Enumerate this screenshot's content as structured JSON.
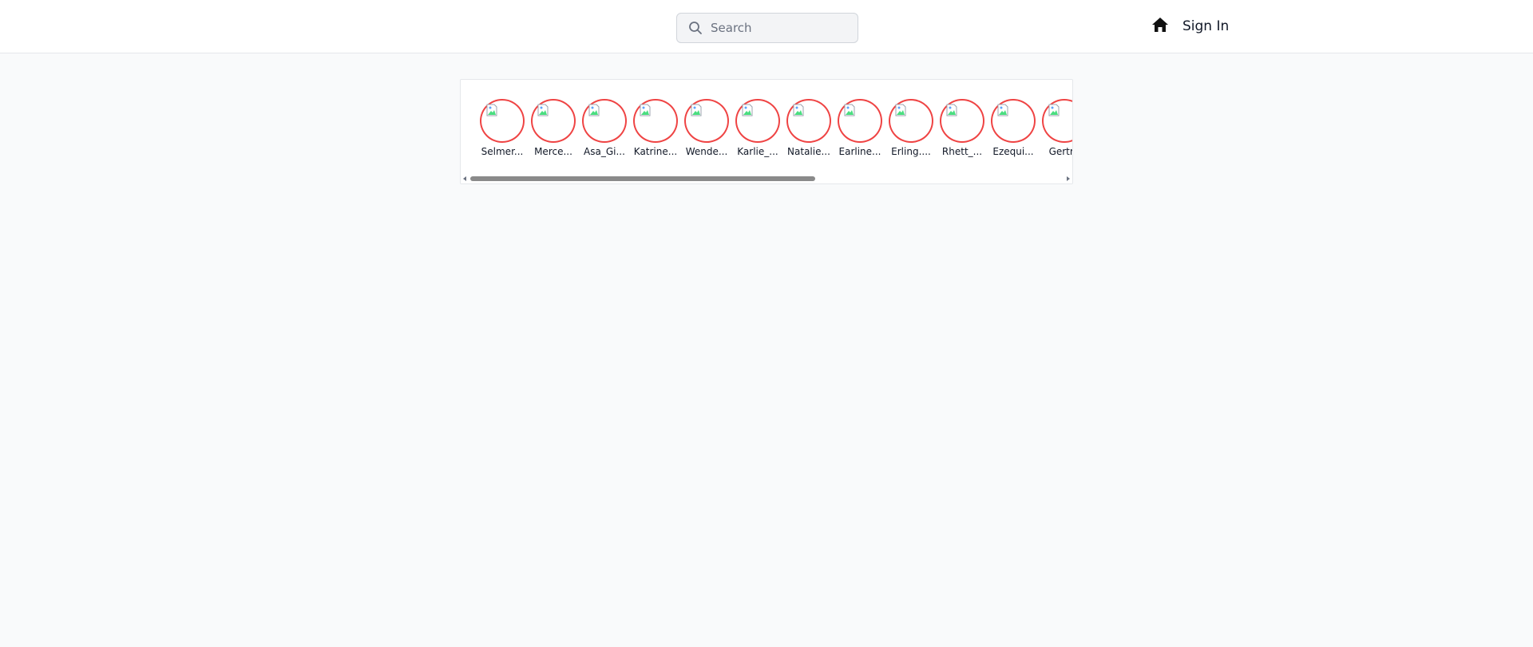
{
  "header": {
    "search": {
      "placeholder": "Search",
      "value": ""
    },
    "home_icon": "home-icon",
    "signin_label": "Sign In"
  },
  "stories": {
    "items": [
      {
        "label": "Selmer..."
      },
      {
        "label": "Merce..."
      },
      {
        "label": "Asa_Gi..."
      },
      {
        "label": "Katrine..."
      },
      {
        "label": "Wende..."
      },
      {
        "label": "Karlie_..."
      },
      {
        "label": "Natalie..."
      },
      {
        "label": "Earline..."
      },
      {
        "label": "Erling...."
      },
      {
        "label": "Rhett_..."
      },
      {
        "label": "Ezequi..."
      },
      {
        "label": "Gertru"
      }
    ],
    "ring_color": "#ef4444",
    "scroll_position_fraction": 0.0
  }
}
